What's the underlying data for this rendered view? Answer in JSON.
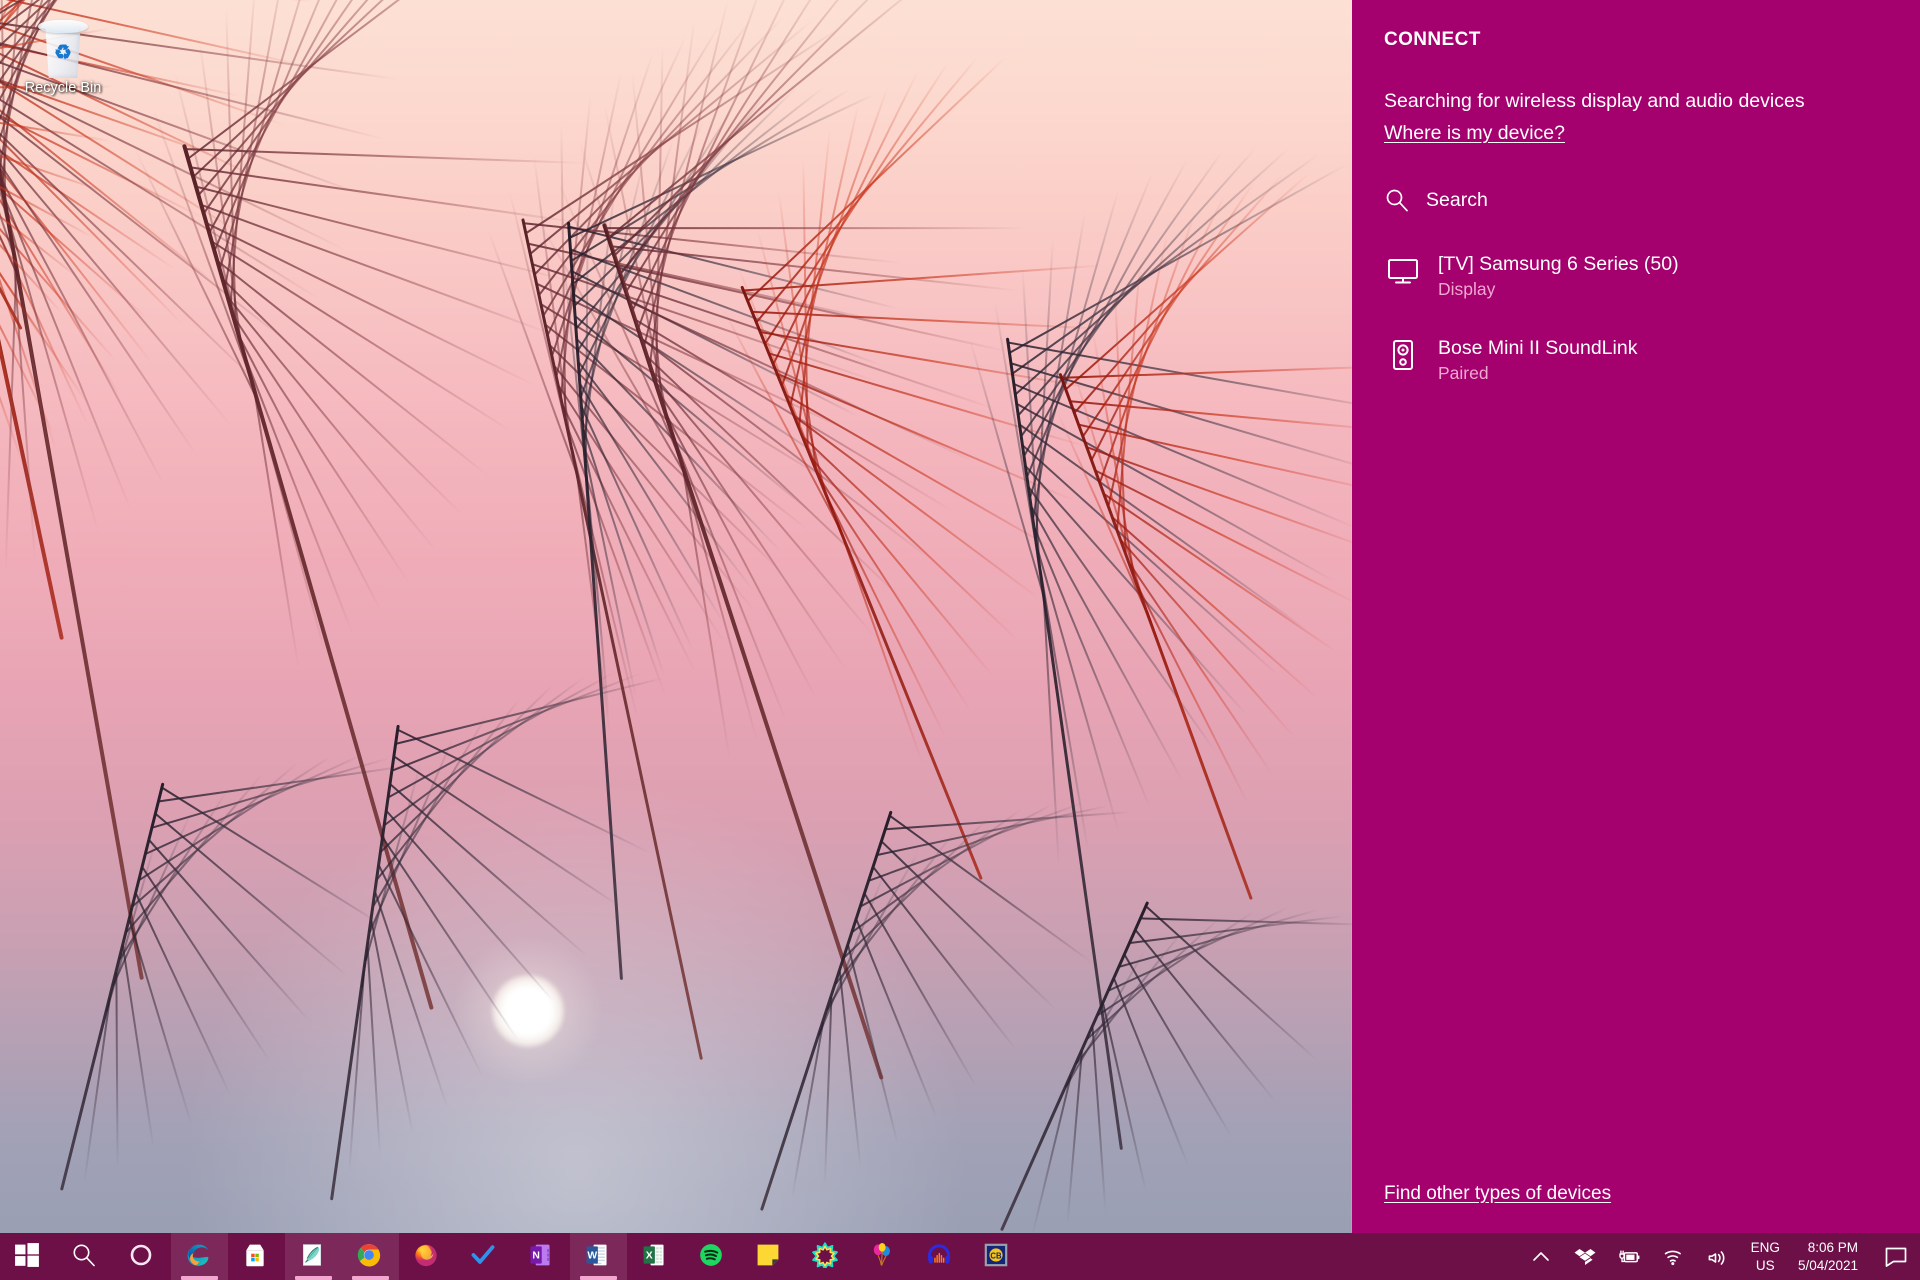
{
  "desktop": {
    "icons": [
      {
        "label": "Recycle Bin",
        "icon": "recycle-bin-icon"
      }
    ],
    "wallpaper_description": "Pink sunset sky with silhouetted pampas grass plumes",
    "colors": {
      "sky_top": "#fde0d4",
      "sky_mid": "#efacb8",
      "sky_bottom": "#9a9fb4",
      "grass_red": "#96140a",
      "grass_dark": "#281e2d"
    }
  },
  "connect": {
    "title": "CONNECT",
    "status_text": "Searching for wireless display and audio devices",
    "where_link": "Where is my device?",
    "search_label": "Search",
    "search_icon": "search-icon",
    "find_other_link": "Find other types of devices",
    "accent_color": "#a4006e",
    "subtext_color": "#f0a8cf",
    "devices": [
      {
        "name": "[TV] Samsung 6 Series (50)",
        "status": "Display",
        "icon": "monitor-icon"
      },
      {
        "name": "Bose Mini II SoundLink",
        "status": "Paired",
        "icon": "speaker-icon"
      }
    ]
  },
  "taskbar": {
    "background_color": "#6e1048",
    "indicator_color": "#f3a6cf",
    "items": [
      {
        "name": "start-button",
        "icon": "windows-logo-icon",
        "label": "Start",
        "running": false
      },
      {
        "name": "search-button",
        "icon": "search-icon",
        "label": "Type here to search",
        "running": false
      },
      {
        "name": "cortana-button",
        "icon": "cortana-icon",
        "label": "Cortana",
        "running": false
      },
      {
        "name": "edge-button",
        "icon": "edge-icon",
        "label": "Microsoft Edge",
        "running": true
      },
      {
        "name": "store-button",
        "icon": "microsoft-store-icon",
        "label": "Microsoft Store",
        "running": false
      },
      {
        "name": "paint3d-button",
        "icon": "paint-feather-icon",
        "label": "Paint",
        "running": true
      },
      {
        "name": "chrome-button",
        "icon": "chrome-icon",
        "label": "Google Chrome",
        "running": true
      },
      {
        "name": "firefox-button",
        "icon": "firefox-icon",
        "label": "Mozilla Firefox",
        "running": false
      },
      {
        "name": "todo-button",
        "icon": "checkmark-icon",
        "label": "Microsoft To Do",
        "running": false
      },
      {
        "name": "onenote-button",
        "icon": "onenote-icon",
        "label": "OneNote",
        "running": false
      },
      {
        "name": "word-button",
        "icon": "word-icon",
        "label": "Word",
        "running": true
      },
      {
        "name": "excel-button",
        "icon": "excel-icon",
        "label": "Excel",
        "running": false
      },
      {
        "name": "spotify-button",
        "icon": "spotify-icon",
        "label": "Spotify",
        "running": false
      },
      {
        "name": "sticky-notes-button",
        "icon": "sticky-notes-icon",
        "label": "Sticky Notes",
        "running": false
      },
      {
        "name": "starburst-button",
        "icon": "starburst-icon",
        "label": "Photos",
        "running": false
      },
      {
        "name": "balloons-button",
        "icon": "balloons-icon",
        "label": "Balloons",
        "running": false
      },
      {
        "name": "headphones-button",
        "icon": "headphones-icon",
        "label": "Audio App",
        "running": false
      },
      {
        "name": "cb-button",
        "icon": "cb-badge-icon",
        "label": "CB",
        "running": false
      }
    ],
    "tray": {
      "overflow_icon": "chevron-up-icon",
      "icons": [
        {
          "name": "dropbox-tray-icon",
          "icon": "dropbox-icon"
        },
        {
          "name": "battery-tray-icon",
          "icon": "battery-charging-icon"
        },
        {
          "name": "network-tray-icon",
          "icon": "wifi-icon"
        },
        {
          "name": "volume-tray-icon",
          "icon": "volume-icon"
        }
      ],
      "language": {
        "line1": "ENG",
        "line2": "US"
      },
      "clock": {
        "time": "8:06 PM",
        "date": "5/04/2021"
      },
      "action_center_icon": "action-center-icon"
    }
  }
}
